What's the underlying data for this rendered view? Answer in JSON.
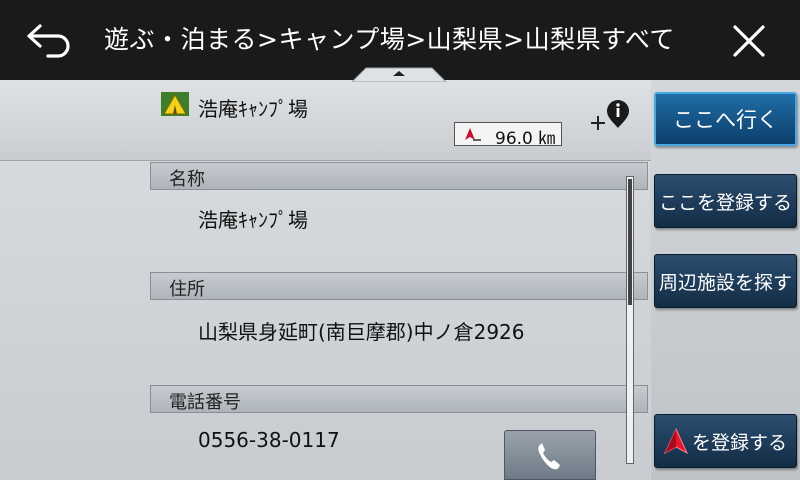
{
  "header": {
    "title": "遊ぶ・泊まる>キャンプ場>山梨県>山梨県すべて",
    "back_icon": "back-arrow-icon",
    "close_icon": "close-icon"
  },
  "summary": {
    "name": "浩庵ｷｬﾝﾌﾟ場",
    "distance": "96.0 ㎞",
    "category_icon": "campground-icon",
    "info_icon": "location-info-icon"
  },
  "details": {
    "sections": [
      {
        "label": "名称",
        "value": "浩庵ｷｬﾝﾌﾟ場"
      },
      {
        "label": "住所",
        "value": "山梨県身延町(南巨摩郡)中ノ倉2926"
      },
      {
        "label": "電話番号",
        "value": "0556-38-0117"
      }
    ],
    "call_icon": "phone-icon"
  },
  "actions": {
    "go_here": "ここへ行く",
    "register_here": "ここを登録する",
    "search_nearby": "周辺施設を探す",
    "register_marker": "を登録する"
  },
  "colors": {
    "header_bg": "#1a1a1a",
    "primary_button": "#1f6da6",
    "button": "#1c3b5a",
    "marker_red": "#c8102e"
  }
}
